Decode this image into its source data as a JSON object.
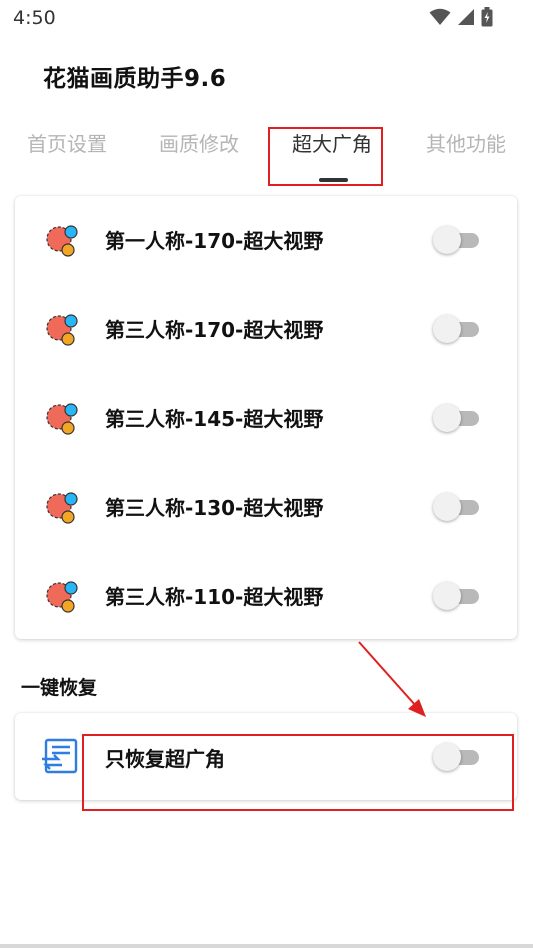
{
  "status_bar": {
    "time": "4:50"
  },
  "app": {
    "title": "花猫画质助手9.6"
  },
  "tabs": [
    {
      "label": "首页设置",
      "active": false
    },
    {
      "label": "画质修改",
      "active": false
    },
    {
      "label": "超大广角",
      "active": true
    },
    {
      "label": "其他功能",
      "active": false
    }
  ],
  "options": [
    {
      "label": "第一人称-170-超大视野",
      "enabled": false,
      "icon": "bubbles-icon"
    },
    {
      "label": "第三人称-170-超大视野",
      "enabled": false,
      "icon": "bubbles-icon"
    },
    {
      "label": "第三人称-145-超大视野",
      "enabled": false,
      "icon": "bubbles-icon"
    },
    {
      "label": "第三人称-130-超大视野",
      "enabled": false,
      "icon": "bubbles-icon"
    },
    {
      "label": "第三人称-110-超大视野",
      "enabled": false,
      "icon": "bubbles-icon"
    }
  ],
  "restore_section": {
    "title": "一键恢复",
    "item": {
      "label": "只恢复超广角",
      "enabled": false,
      "icon": "restore-list-icon"
    }
  },
  "colors": {
    "highlight": "#e02020",
    "accent_blue": "#2f7de1",
    "bubble_red": "#f06a5a",
    "bubble_orange": "#f3a623",
    "bubble_cyan": "#29b6f6"
  }
}
